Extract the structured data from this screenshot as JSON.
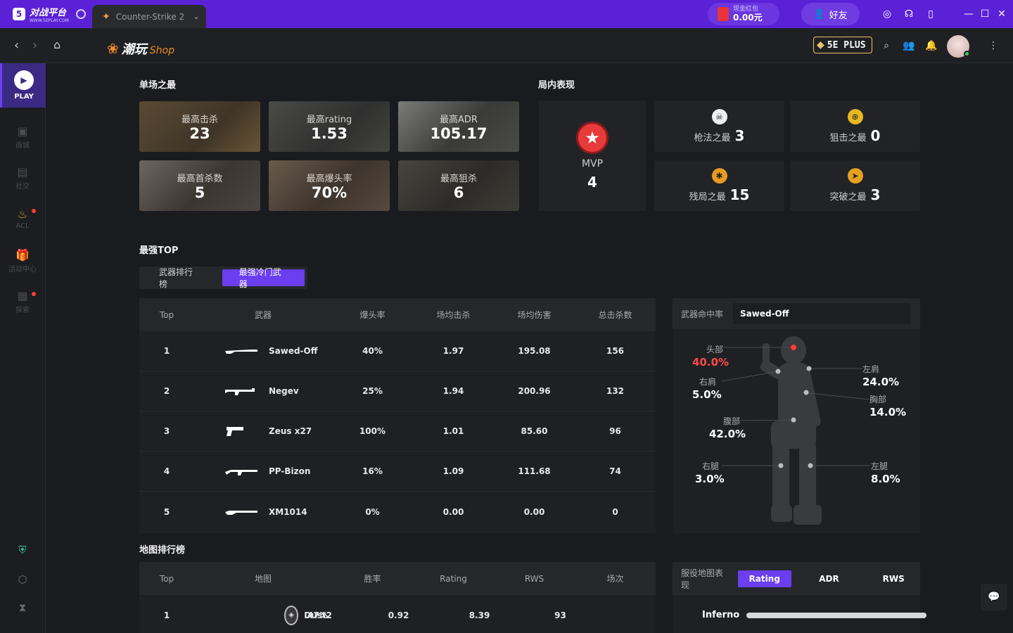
{
  "titlebar": {
    "logo_text": "对战平台",
    "logo_sub": "WWW.5EPLAY.COM",
    "game_tab": "Counter-Strike 2",
    "redpack_label": "现金红包",
    "redpack_amount": "0.00元",
    "friends_label": "好友"
  },
  "navbar": {
    "brand_main": "潮玩",
    "brand_sub": "Shop",
    "plus_label": "5E PLUS"
  },
  "sidebar": {
    "play_label": "PLAY",
    "items": [
      {
        "label": "商城",
        "icon": "bag-icon"
      },
      {
        "label": "社交",
        "icon": "chat-icon"
      },
      {
        "label": "ACL",
        "icon": "acl-icon"
      },
      {
        "label": "活动中心",
        "icon": "gift-icon"
      },
      {
        "label": "探索",
        "icon": "grid-icon"
      }
    ]
  },
  "single_best": {
    "title": "单场之最",
    "tiles": [
      {
        "label": "最高击杀",
        "value": "23"
      },
      {
        "label": "最高rating",
        "value": "1.53"
      },
      {
        "label": "最高ADR",
        "value": "105.17"
      },
      {
        "label": "最高首杀数",
        "value": "5"
      },
      {
        "label": "最高爆头率",
        "value": "70%"
      },
      {
        "label": "最高狙杀",
        "value": "6"
      }
    ]
  },
  "in_game": {
    "title": "局内表现",
    "mvp_label": "MVP",
    "mvp_value": "4",
    "items": [
      {
        "label": "枪法之最",
        "value": "3"
      },
      {
        "label": "狙击之最",
        "value": "0"
      },
      {
        "label": "残局之最",
        "value": "15"
      },
      {
        "label": "突破之最",
        "value": "3"
      }
    ]
  },
  "top_section": {
    "title": "最强TOP",
    "tabs": [
      "武器排行榜",
      "最强冷门武器"
    ]
  },
  "weapon_table": {
    "headers": [
      "Top",
      "武器",
      "爆头率",
      "场均击杀",
      "场均伤害",
      "总击杀数"
    ],
    "rows": [
      {
        "rank": "1",
        "name": "Sawed-Off",
        "hs": "40%",
        "kpg": "1.97",
        "dmg": "195.08",
        "kills": "156"
      },
      {
        "rank": "2",
        "name": "Negev",
        "hs": "25%",
        "kpg": "1.94",
        "dmg": "200.96",
        "kills": "132"
      },
      {
        "rank": "3",
        "name": "Zeus x27",
        "hs": "100%",
        "kpg": "1.01",
        "dmg": "85.60",
        "kills": "96"
      },
      {
        "rank": "4",
        "name": "PP-Bizon",
        "hs": "16%",
        "kpg": "1.09",
        "dmg": "111.68",
        "kills": "74"
      },
      {
        "rank": "5",
        "name": "XM1014",
        "hs": "0%",
        "kpg": "0.00",
        "dmg": "0.00",
        "kills": "0"
      }
    ]
  },
  "hit_rate": {
    "label": "武器命中率",
    "selected_weapon": "Sawed-Off",
    "parts": {
      "head": {
        "label": "头部",
        "value": "40.0%"
      },
      "right_shoulder": {
        "label": "右肩",
        "value": "5.0%"
      },
      "left_shoulder": {
        "label": "左肩",
        "value": "24.0%"
      },
      "chest": {
        "label": "胸部",
        "value": "14.0%"
      },
      "stomach": {
        "label": "腹部",
        "value": "42.0%"
      },
      "right_leg": {
        "label": "右腿",
        "value": "3.0%"
      },
      "left_leg": {
        "label": "左腿",
        "value": "8.0%"
      }
    }
  },
  "map_rank": {
    "title": "地图排行榜",
    "headers": [
      "Top",
      "地图",
      "胜率",
      "Rating",
      "RWS",
      "场次"
    ],
    "rows": [
      {
        "rank": "1",
        "name": "Dust2",
        "win": "47%",
        "rating": "0.92",
        "rws": "8.39",
        "games": "93"
      }
    ]
  },
  "map_perf": {
    "label": "服役地图表现",
    "segments": [
      "Rating",
      "ADR",
      "RWS"
    ],
    "active": "Rating",
    "first_map": "Inferno"
  },
  "colors": {
    "accent": "#6b3ef0",
    "titlebar": "#5b21d6",
    "danger": "#ff4a4a"
  }
}
